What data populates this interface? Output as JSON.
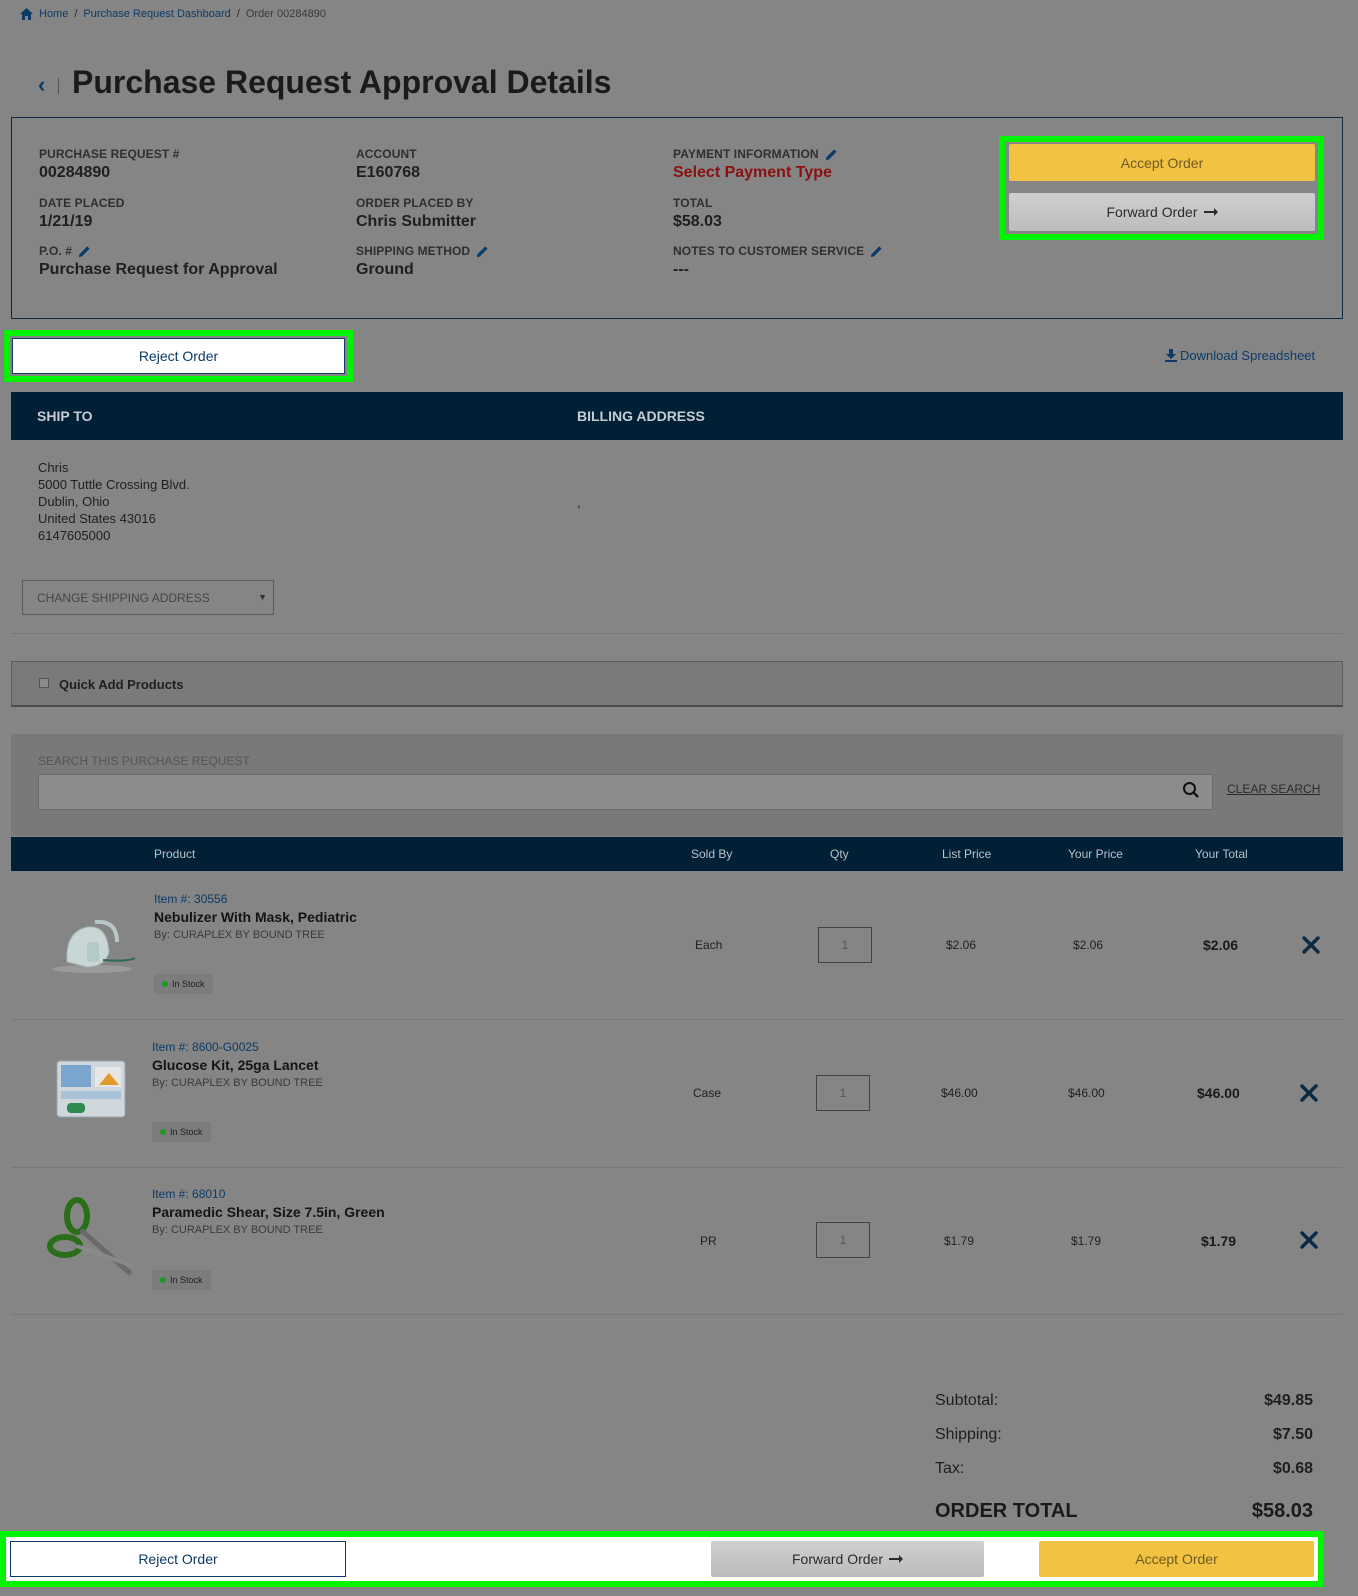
{
  "breadcrumb": {
    "home": "Home",
    "dashboard": "Purchase Request Dashboard",
    "current": "Order 00284890",
    "sep": "/"
  },
  "page": {
    "back": "‹",
    "title": "Purchase Request Approval Details"
  },
  "summary": {
    "pr_label": "PURCHASE REQUEST #",
    "pr_value": "00284890",
    "date_label": "DATE PLACED",
    "date_value": "1/21/19",
    "po_label": "P.O. #",
    "po_value": "Purchase Request for Approval",
    "account_label": "ACCOUNT",
    "account_value": "E160768",
    "placed_by_label": "ORDER PLACED BY",
    "placed_by_value": "Chris Submitter",
    "shipping_label": "SHIPPING METHOD",
    "shipping_value": "Ground",
    "payment_label": "PAYMENT INFORMATION",
    "payment_value": "Select Payment Type",
    "total_label": "TOTAL",
    "total_value": "$58.03",
    "notes_label": "NOTES TO CUSTOMER SERVICE",
    "notes_value": "---"
  },
  "actions": {
    "accept": "Accept Order",
    "forward": "Forward Order",
    "reject": "Reject Order",
    "download": "Download Spreadsheet"
  },
  "addresses": {
    "ship_to_label": "SHIP TO",
    "billing_label": "BILLING ADDRESS",
    "ship_lines": [
      "Chris",
      "5000 Tuttle Crossing Blvd.",
      "Dublin, Ohio",
      "United States 43016",
      "6147605000"
    ],
    "billing_value": ",",
    "change_select": "CHANGE SHIPPING ADDRESS"
  },
  "quick_add": {
    "label": "Quick Add Products"
  },
  "search": {
    "label": "SEARCH THIS PURCHASE REQUEST",
    "placeholder": "",
    "clear": "CLEAR SEARCH"
  },
  "table": {
    "headers": [
      "Product",
      "Sold By",
      "Qty",
      "List Price",
      "Your Price",
      "Your Total"
    ],
    "rows": [
      {
        "item": "Item #: 30556",
        "name": "Nebulizer With Mask, Pediatric",
        "by": "By: CURAPLEX BY BOUND TREE",
        "stock": "In Stock",
        "sold_by": "Each",
        "qty": "1",
        "list": "$2.06",
        "price": "$2.06",
        "total": "$2.06"
      },
      {
        "item": "Item #: 8600-G0025",
        "name": "Glucose Kit, 25ga Lancet",
        "by": "By: CURAPLEX BY BOUND TREE",
        "stock": "In Stock",
        "sold_by": "Case",
        "qty": "1",
        "list": "$46.00",
        "price": "$46.00",
        "total": "$46.00"
      },
      {
        "item": "Item #: 68010",
        "name": "Paramedic Shear, Size 7.5in, Green",
        "by": "By: CURAPLEX BY BOUND TREE",
        "stock": "In Stock",
        "sold_by": "PR",
        "qty": "1",
        "list": "$1.79",
        "price": "$1.79",
        "total": "$1.79"
      }
    ]
  },
  "totals": {
    "subtotal_label": "Subtotal:",
    "subtotal": "$49.85",
    "shipping_label": "Shipping:",
    "shipping": "$7.50",
    "tax_label": "Tax:",
    "tax": "$0.68",
    "order_total_label": "ORDER TOTAL",
    "order_total": "$58.03"
  },
  "colors": {
    "accent_yellow": "#f2c242",
    "navy": "#002135",
    "highlight": "#00f400",
    "red": "#8a1010"
  }
}
